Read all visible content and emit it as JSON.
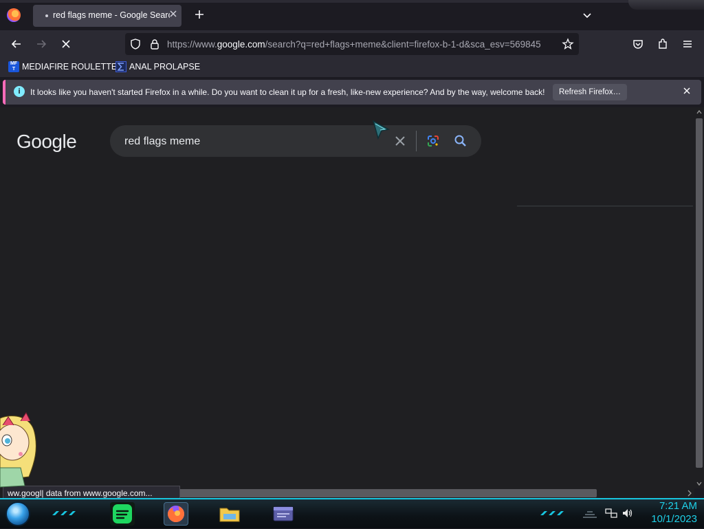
{
  "browser": {
    "tab": {
      "title": "red flags meme - Google Search"
    },
    "url": {
      "prefix": "https://www.",
      "host": "google.com",
      "rest": "/search?q=red+flags+meme&client=firefox-b-1-d&sca_esv=569845"
    },
    "bookmarks": [
      {
        "label": "MEDIAFIRE ROULETTER",
        "icon": "mediafire-icon"
      },
      {
        "label": "ANAL PROLAPSE",
        "icon": "bookmark-sigma-icon"
      }
    ],
    "notification": {
      "text": "It looks like you haven't started Firefox in a while. Do you want to clean it up for a fresh, like-new experience? And by the way, welcome back!",
      "button": "Refresh Firefox…"
    },
    "status_text": "ww.googl| data from www.google.com..."
  },
  "page": {
    "logo_text": "Google",
    "search_query": "red flags meme"
  },
  "taskbar": {
    "time": "7:21 AM",
    "date": "10/1/2023"
  },
  "colors": {
    "tab_bg": "#42414d",
    "toolbar_bg": "#2b2a33",
    "page_bg": "#1f1f22",
    "accent_cyan": "#1fd0e8"
  }
}
